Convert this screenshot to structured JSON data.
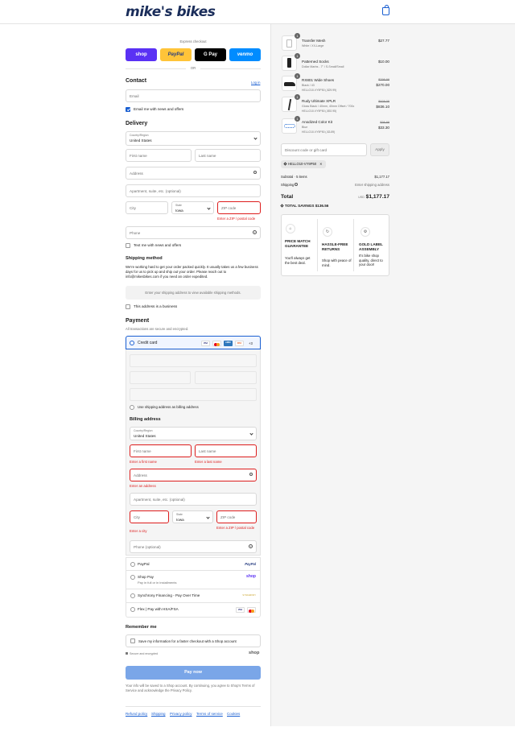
{
  "header": {
    "logo": "mike's bikes",
    "cart_icon": "shopping-bag-icon"
  },
  "express": {
    "title": "Express checkout",
    "buttons": [
      "shop",
      "PayPal",
      "G Pay",
      "venmo"
    ],
    "or": "OR"
  },
  "contact": {
    "heading": "Contact",
    "login": "Log in",
    "email_placeholder": "Email",
    "email_news": "Email me with news and offers"
  },
  "delivery": {
    "heading": "Delivery",
    "country_label": "Country/Region",
    "country": "United States",
    "first_name": "First name",
    "last_name": "Last name",
    "address": "Address",
    "apartment": "Apartment, suite, etc. (optional)",
    "city": "City",
    "state_label": "State",
    "state": "Iowa",
    "zip": "ZIP code",
    "zip_error": "Enter a ZIP / postal code",
    "phone": "Phone",
    "text_news": "Text me with news and offers"
  },
  "shipping": {
    "heading": "Shipping method",
    "text": "We're working hard to get your order packed quickly. It usually takes us a few business days for us to pick up and ship out your order. Please reach out to info@mikesbikes.com if you need an order expedited.",
    "placeholder": "Enter your shipping address to view available shipping methods.",
    "business": "This address is a business"
  },
  "payment": {
    "heading": "Payment",
    "subtext": "All transactions are secure and encrypted.",
    "credit_card": "Credit card",
    "more_cards": "+3",
    "cards": [
      "VISA",
      "MC",
      "AMEX",
      "DISC"
    ],
    "use_shipping": "Use shipping address as billing address",
    "billing_heading": "Billing address",
    "country_label": "Country/Region",
    "country": "United States",
    "first_name": "First name",
    "last_name": "Last name",
    "first_error": "Enter a first name",
    "last_error": "Enter a last name",
    "address": "Address",
    "address_error": "Enter an address",
    "apartment": "Apartment, suite, etc. (optional)",
    "city": "City",
    "state_label": "State",
    "state": "Iowa",
    "zip": "ZIP code",
    "city_error": "Enter a city",
    "zip_error": "Enter a ZIP / postal code",
    "phone": "Phone (optional)",
    "options": [
      {
        "label": "PayPal",
        "sub": "",
        "badge": "PayPal"
      },
      {
        "label": "Shop Pay",
        "sub": "Pay in full or in installments",
        "badge": "shop"
      },
      {
        "label": "Synchrony Financing - Pay Over Time",
        "sub": "",
        "badge": "SYNCHRONY"
      },
      {
        "label": "Flex | Pay with HSA/FSA",
        "sub": "",
        "badge": ""
      }
    ]
  },
  "remember": {
    "heading": "Remember me",
    "save": "Save my information for a faster checkout with a Shop account",
    "secure": "Secure and encrypted",
    "shop": "shop"
  },
  "pay_now": "Pay now",
  "terms": "Your info will be saved to a Shop account. By continuing, you agree to Shop's Terms of Service and acknowledge the Privacy Policy.",
  "footer": [
    "Refund policy",
    "Shipping",
    "Privacy policy",
    "Terms of service",
    "Cookies"
  ],
  "summary": {
    "items": [
      {
        "qty": "1",
        "name": "Transfer Mesh",
        "variant": "White / XX-Large",
        "discount": "",
        "price": "$27.77",
        "old": ""
      },
      {
        "qty": "1",
        "name": "Patterned Socks",
        "variant": "Dollar Marbs - 7\" / S-Small/Small",
        "discount": "",
        "price": "$10.00",
        "old": ""
      },
      {
        "qty": "1",
        "name": "RX801 Wide Shoes",
        "variant": "Black / 43",
        "discount": "HELLO10-VY9P50 (-$29.99)",
        "price": "$270.00",
        "old": "$299.99"
      },
      {
        "qty": "1",
        "name": "Rudy Ultimate XPLR",
        "variant": "Gloss Black / 40mm, 40mm Offset / 700c",
        "discount": "HELLO10-VY9P50 (-$92.95)",
        "price": "$836.10",
        "old": "$929.05"
      },
      {
        "qty": "1",
        "name": "Anodized Color Kit",
        "variant": "Blue",
        "discount": "HELLO10-VY9P50 (-$3.89)",
        "price": "$33.30",
        "old": "$36.99"
      }
    ],
    "discount_placeholder": "Discount code or gift card",
    "apply": "Apply",
    "code": "HELLO10-VY9P50",
    "subtotal_label": "Subtotal · 5 items",
    "subtotal": "$1,177.17",
    "shipping_label": "Shipping",
    "shipping": "Enter shipping address",
    "total_label": "Total",
    "currency": "USD",
    "total": "$1,177.17",
    "savings_label": "TOTAL SAVINGS",
    "savings": "$136.56",
    "perks": [
      {
        "title": "PRICE MATCH GUARANTEE",
        "text": "You'll always get the best deal.",
        "icon": "tag-icon"
      },
      {
        "title": "HASSLE-FREE RETURNS",
        "text": "Shop with peace of mind.",
        "icon": "return-icon"
      },
      {
        "title": "GOLD LABEL ASSEMBLY",
        "text": "It's bike shop quality, direct to your door!",
        "icon": "gear-icon"
      }
    ]
  },
  "colors": {
    "accent": "#1a5fd1",
    "error": "#dd1d1d",
    "paynow": "#7aa6e8"
  }
}
